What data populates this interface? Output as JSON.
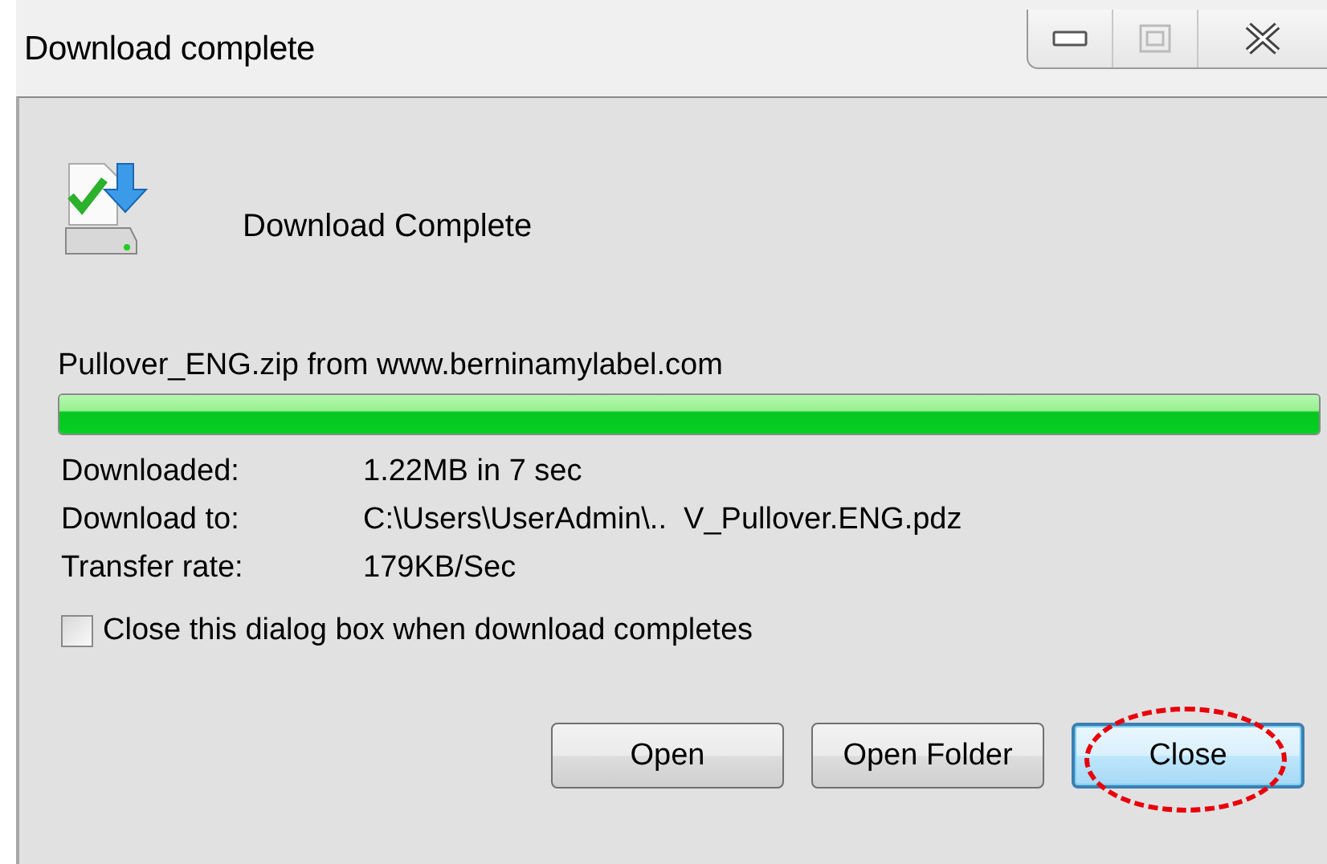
{
  "window": {
    "title": "Download complete"
  },
  "header": {
    "text": "Download Complete"
  },
  "source": "Pullover_ENG.zip from www.berninamylabel.com",
  "progress": {
    "level": 1
  },
  "details": [
    {
      "label": "Downloaded:",
      "value": "1.22MB in 7 sec"
    },
    {
      "label": "Download to:",
      "value": "C:\\Users\\UserAdmin\\..  V_Pullover.ENG.pdz"
    },
    {
      "label": "Transfer rate:",
      "value": "179KB/Sec"
    }
  ],
  "close_option": {
    "label": "Close this dialog box when download completes",
    "checked": false
  },
  "buttons": [
    {
      "label": "Open",
      "default": false,
      "circled": false
    },
    {
      "label": "Open Folder",
      "default": false,
      "circled": false
    },
    {
      "label": "Close",
      "default": true,
      "circled": true
    }
  ]
}
